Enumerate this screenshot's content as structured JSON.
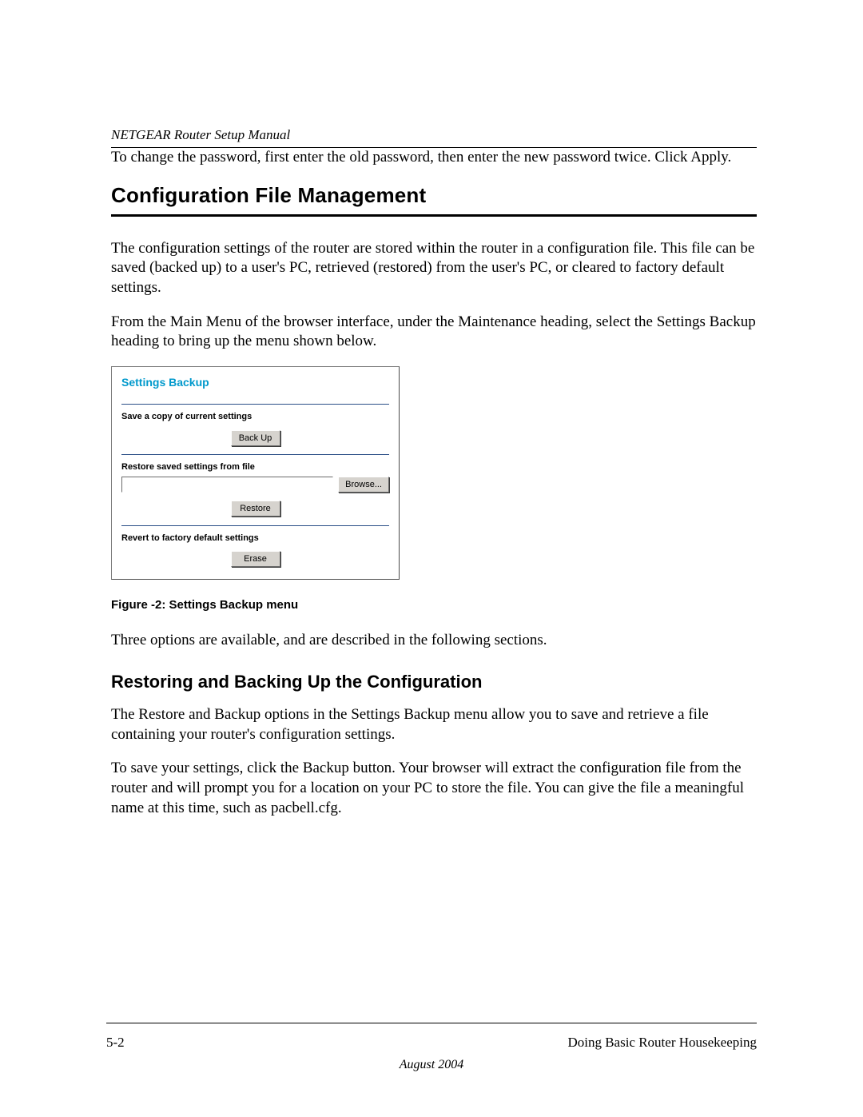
{
  "header": {
    "manual_title": "NETGEAR Router Setup Manual"
  },
  "intro_paragraph": "To change the password, first enter the old password, then enter the new password twice. Click Apply.",
  "section": {
    "title": "Configuration File Management",
    "p1": "The configuration settings of the router are stored within the router in a configuration file. This file can be saved (backed up) to a user's PC, retrieved (restored) from the user's PC, or cleared to factory default settings.",
    "p2": "From the Main Menu of the browser interface, under the Maintenance heading, select the Settings Backup heading to bring up the menu shown below."
  },
  "screenshot": {
    "panel_title": "Settings Backup",
    "save": {
      "label": "Save a copy of current settings",
      "button": "Back Up"
    },
    "restore": {
      "label": "Restore saved settings from file",
      "file_value": "",
      "browse_button": "Browse...",
      "restore_button": "Restore"
    },
    "revert": {
      "label": "Revert to factory default settings",
      "button": "Erase"
    }
  },
  "figure_caption": "Figure -2:  Settings Backup menu",
  "after_figure_paragraph": "Three options are available, and are described in the following sections.",
  "subsection": {
    "title": "Restoring and Backing Up the Configuration",
    "p1": "The Restore and Backup options in the Settings Backup menu allow you to save and retrieve a file containing your router's configuration settings.",
    "p2": "To save your settings, click the Backup button. Your browser will extract the configuration file from the router and will prompt you for a location on your PC to store the file. You can give the file a meaningful name at this time, such as pacbell.cfg."
  },
  "footer": {
    "page_number": "5-2",
    "chapter_title": "Doing Basic Router Housekeeping",
    "date": "August 2004"
  }
}
